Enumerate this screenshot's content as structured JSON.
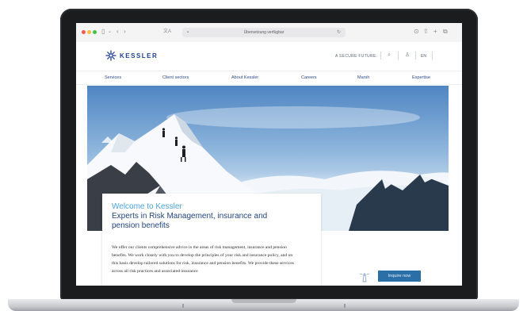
{
  "browser": {
    "url": "Übersetzung verfügbar",
    "icons": {
      "sidebar": "sidebar-icon",
      "back": "back-icon",
      "forward": "forward-icon",
      "translate": "translate-icon",
      "download": "download-icon",
      "share": "share-icon",
      "new_tab": "new-tab-icon",
      "tabs": "tabs-icon"
    }
  },
  "header": {
    "logo_text": "KESSLER",
    "tagline": "A SECURE FUTURE.",
    "language": "EN"
  },
  "nav": {
    "items": [
      {
        "label": "Services"
      },
      {
        "label": "Client sectors"
      },
      {
        "label": "About Kessler"
      },
      {
        "label": "Careers"
      },
      {
        "label": "Marsh"
      },
      {
        "label": "Expertise"
      }
    ]
  },
  "welcome": {
    "title": "Welcome to Kessler",
    "subtitle": "Experts in Risk Management, insurance and pension benefits",
    "body": "We offer our clients comprehensive advice in the areas of risk management, insurance and pension benefits. We work closely with you to develop the principles of your risk and insurance policy, and on this basis develop tailored solutions for risk, insurance and pension benefits. We provide these services across all risk practices and associated insurance"
  },
  "cta": {
    "label": "Inquire now"
  },
  "colors": {
    "brand": "#1f3f8f",
    "accent": "#4aa3dd",
    "button": "#2a6fa8"
  }
}
